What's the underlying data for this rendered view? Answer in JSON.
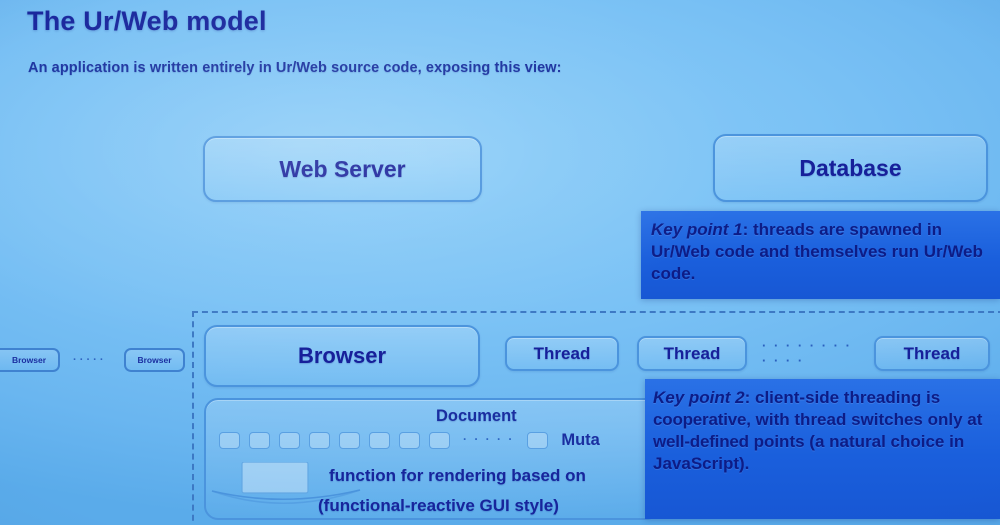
{
  "slide": {
    "title": "The Ur/Web model",
    "subtitle": "An application is written entirely in Ur/Web source code, exposing this view:"
  },
  "nodes": {
    "web_server": "Web Server",
    "database": "Database",
    "browser": "Browser",
    "threads": [
      "Thread",
      "Thread",
      "Thread"
    ],
    "thread_ellipsis": "· · · · · · · · · · · ·",
    "mini_browsers": [
      "Browser",
      "Browser"
    ],
    "mini_ellipsis": "· · · · ·"
  },
  "document_panel": {
    "label": "Document",
    "dom_node_count": 8,
    "dom_ellipsis": "· · · · ·",
    "mutable_label": "Muta",
    "render_line_1": "function for rendering based on",
    "render_line_2": "(functional-reactive GUI style)"
  },
  "callouts": {
    "key_point_1": {
      "lead": "Key point 1",
      "body": ": threads are spawned in Ur/Web code and themselves run Ur/Web code."
    },
    "key_point_2": {
      "lead": "Key point 2",
      "body_a": ": client-side threading is ",
      "emphasis_a": "cooperative",
      "body_b": ", with thread switches only at ",
      "emphasis_b": "well-defined",
      "body_c": " points (a natural choice in JavaScript)."
    }
  },
  "colors": {
    "background": "#79c1f4",
    "node_border": "#4b94dd",
    "text_navy": "#17259c",
    "callout_bg": "#1d63de",
    "dashed_border": "#3d79c4"
  }
}
